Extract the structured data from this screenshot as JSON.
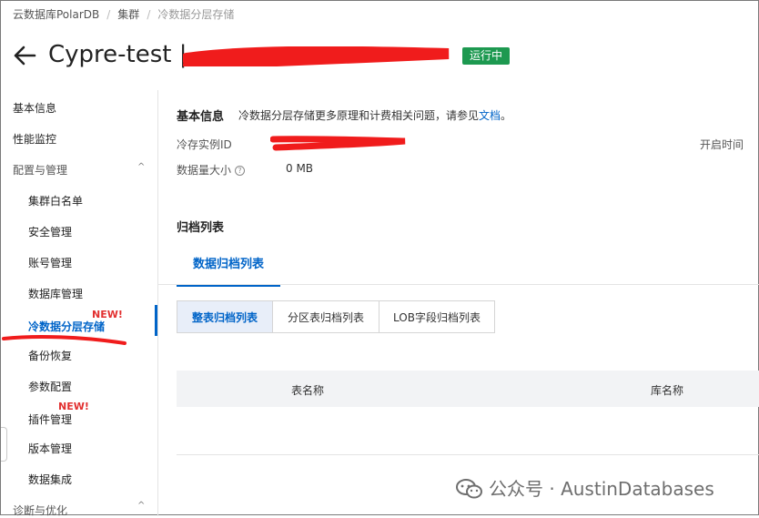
{
  "breadcrumb": [
    "云数据库PolarDB",
    "集群",
    "冷数据分层存储"
  ],
  "header": {
    "title": "Cypre-test |",
    "status": "运行中"
  },
  "sidebar": {
    "items": [
      {
        "label": "基本信息"
      },
      {
        "label": "性能监控"
      },
      {
        "label": "配置与管理"
      },
      {
        "label": "集群白名单"
      },
      {
        "label": "安全管理"
      },
      {
        "label": "账号管理"
      },
      {
        "label": "数据库管理"
      },
      {
        "label": "冷数据分层存储",
        "badge": "NEW!"
      },
      {
        "label": "备份恢复"
      },
      {
        "label": "参数配置"
      },
      {
        "label": "插件管理",
        "badge": "NEW!"
      },
      {
        "label": "版本管理"
      },
      {
        "label": "数据集成"
      },
      {
        "label": "诊断与优化"
      }
    ]
  },
  "basic_info": {
    "title": "基本信息",
    "desc": "冷数据分层存储更多原理和计费相关问题，请参见",
    "doc_link": "文档",
    "period": "。",
    "instance_id_label": "冷存实例ID",
    "start_time_label": "开启时间",
    "data_size_label": "数据量大小",
    "data_size_value": "0 MB"
  },
  "archive": {
    "title": "归档列表",
    "tab": "数据归档列表",
    "segments": [
      "整表归档列表",
      "分区表归档列表",
      "LOB字段归档列表"
    ],
    "columns": [
      "表名称",
      "库名称"
    ]
  },
  "watermark": "公众号 · AustinDatabases"
}
